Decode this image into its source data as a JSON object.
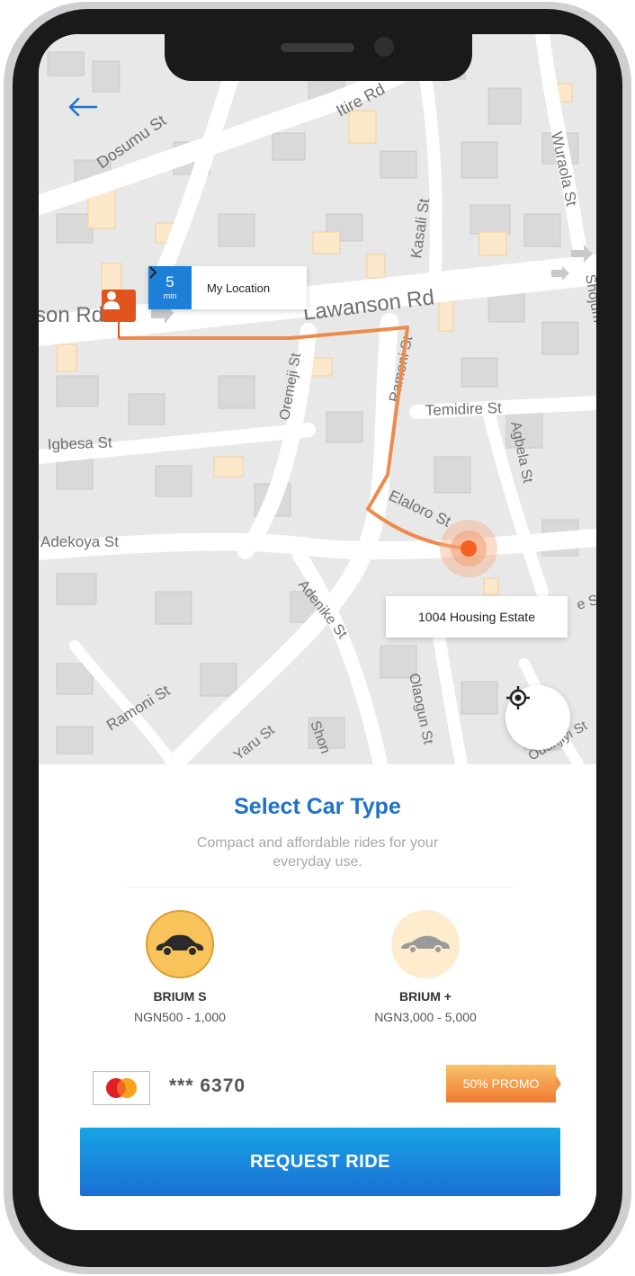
{
  "map": {
    "streets": [
      "Dosumu St",
      "Itire Rd",
      "Wuraola St",
      "Kasali St",
      "Lawanson Rd",
      "son Rd",
      "Ramoni St",
      "Temidire St",
      "Agbela St",
      "Oremeji St",
      "Igbesa St",
      "Elaloro St",
      "Adekoya St",
      "Adenike St",
      "Ramoni St",
      "Yaru St",
      "Shon",
      "Olaogun St",
      "Odunjiyi St",
      "Shojum",
      "e St"
    ],
    "origin": {
      "eta_number": "5",
      "eta_unit": "min",
      "label": "My Location"
    },
    "destination": {
      "label": "1004 Housing Estate"
    },
    "route_color": "#ee8a4a",
    "pin_color": "#e2541d"
  },
  "sheet": {
    "title": "Select Car Type",
    "subtitle": "Compact and affordable rides for your everyday use.",
    "cars": [
      {
        "name": "BRIUM S",
        "price": "NGN500 - 1,000",
        "icon": "car-icon",
        "selected": true
      },
      {
        "name": "BRIUM +",
        "price": "NGN3,000 - 5,000",
        "icon": "car-icon",
        "selected": false
      }
    ],
    "payment": {
      "brand": "MasterCard",
      "card_number": "*** 6370"
    },
    "promo": "50% PROMO",
    "request_button": "REQUEST RIDE"
  },
  "colors": {
    "accent_blue": "#1f72cc",
    "selected_car": "#f8c35a",
    "promo_orange": "#ef7a30"
  }
}
